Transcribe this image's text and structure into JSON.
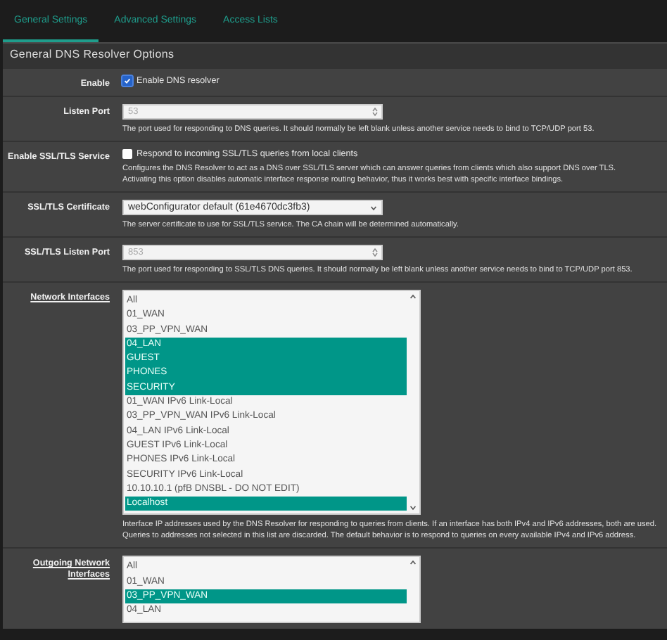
{
  "tabs": [
    {
      "label": "General Settings",
      "selected": true
    },
    {
      "label": "Advanced Settings",
      "selected": false
    },
    {
      "label": "Access Lists",
      "selected": false
    }
  ],
  "panel": {
    "title": "General DNS Resolver Options",
    "rows": [
      {
        "kind": "checkbox",
        "label": "Enable",
        "checked": true,
        "text": "Enable DNS resolver"
      },
      {
        "kind": "number",
        "label": "Listen Port",
        "placeholder": "53",
        "help": [
          "The port used for responding to DNS queries. It should normally be left blank unless another service needs to bind to TCP/UDP port 53."
        ]
      },
      {
        "kind": "checkbox",
        "label": "Enable SSL/TLS Service",
        "checked": false,
        "text": "Respond to incoming SSL/TLS queries from local clients",
        "help": [
          "Configures the DNS Resolver to act as a DNS over SSL/TLS server which can answer queries from clients which also support DNS over TLS.",
          "Activating this option disables automatic interface response routing behavior, thus it works best with specific interface bindings."
        ]
      },
      {
        "kind": "select",
        "label": "SSL/TLS Certificate",
        "value": "webConfigurator default (61e4670dc3fb3)",
        "help": [
          "The server certificate to use for SSL/TLS service. The CA chain will be determined automatically."
        ]
      },
      {
        "kind": "number",
        "label": "SSL/TLS Listen Port",
        "placeholder": "853",
        "help": [
          "The port used for responding to SSL/TLS DNS queries. It should normally be left blank unless another service needs to bind to TCP/UDP port 853."
        ]
      },
      {
        "kind": "listbox",
        "label": "Network Interfaces",
        "options": [
          {
            "label": "All",
            "selected": false
          },
          {
            "label": "01_WAN",
            "selected": false
          },
          {
            "label": "03_PP_VPN_WAN",
            "selected": false
          },
          {
            "label": "04_LAN",
            "selected": true
          },
          {
            "label": "GUEST",
            "selected": true
          },
          {
            "label": "PHONES",
            "selected": true
          },
          {
            "label": "SECURITY",
            "selected": true
          },
          {
            "label": "01_WAN IPv6 Link-Local",
            "selected": false
          },
          {
            "label": "03_PP_VPN_WAN IPv6 Link-Local",
            "selected": false
          },
          {
            "label": "04_LAN IPv6 Link-Local",
            "selected": false
          },
          {
            "label": "GUEST IPv6 Link-Local",
            "selected": false
          },
          {
            "label": "PHONES IPv6 Link-Local",
            "selected": false
          },
          {
            "label": "SECURITY IPv6 Link-Local",
            "selected": false
          },
          {
            "label": "10.10.10.1 (pfB DNSBL - DO NOT EDIT)",
            "selected": false
          },
          {
            "label": "Localhost",
            "selected": true
          }
        ],
        "help": [
          "Interface IP addresses used by the DNS Resolver for responding to queries from clients. If an interface has both IPv4 and IPv6 addresses, both are used. Queries to addresses not selected in this list are discarded. The default behavior is to respond to queries on every available IPv4 and IPv6 address."
        ]
      },
      {
        "kind": "listbox",
        "label": "Outgoing Network Interfaces",
        "options": [
          {
            "label": "All",
            "selected": false
          },
          {
            "label": "01_WAN",
            "selected": false
          },
          {
            "label": "03_PP_VPN_WAN",
            "selected": true
          },
          {
            "label": "04_LAN",
            "selected": false
          }
        ]
      }
    ]
  }
}
